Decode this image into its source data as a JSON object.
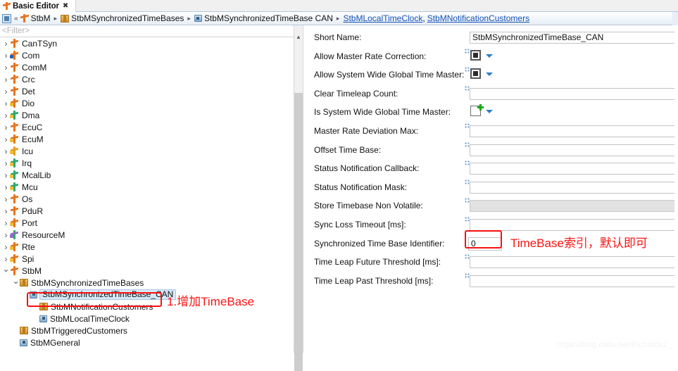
{
  "tab": {
    "label": "Basic Editor",
    "close": "✖",
    "icon": "plug-icon"
  },
  "breadcrumb": {
    "home_icon": "home-icon",
    "collapse": "«",
    "segments": [
      {
        "label": "StbM",
        "icon": "plug-icon"
      },
      {
        "label": "StbMSynchronizedTimeBases",
        "icon": "package-icon"
      },
      {
        "label": "StbMSynchronizedTimeBase CAN",
        "icon": "element-icon"
      }
    ],
    "links": [
      {
        "label": "StbMLocalTimeClock"
      },
      {
        "label": "StbMNotificationCustomers"
      }
    ],
    "separator": "▸",
    "comma": ","
  },
  "filter": {
    "placeholder": "<Filter>",
    "value": "<Filter>"
  },
  "tree": [
    {
      "label": "CanTSyn",
      "depth": 0,
      "twist": "closed",
      "icon": "plug",
      "color": "orange"
    },
    {
      "label": "Com",
      "depth": 0,
      "twist": "closed",
      "icon": "plug",
      "color": "orange-blue"
    },
    {
      "label": "ComM",
      "depth": 0,
      "twist": "closed",
      "icon": "plug",
      "color": "orange"
    },
    {
      "label": "Crc",
      "depth": 0,
      "twist": "closed",
      "icon": "plug",
      "color": "orange"
    },
    {
      "label": "Det",
      "depth": 0,
      "twist": "closed",
      "icon": "plug",
      "color": "orange"
    },
    {
      "label": "Dio",
      "depth": 0,
      "twist": "closed",
      "icon": "plug",
      "color": "orange-yellow"
    },
    {
      "label": "Dma",
      "depth": 0,
      "twist": "closed",
      "icon": "plug",
      "color": "green-yellow"
    },
    {
      "label": "EcuC",
      "depth": 0,
      "twist": "closed",
      "icon": "plug",
      "color": "orange"
    },
    {
      "label": "EcuM",
      "depth": 0,
      "twist": "closed",
      "icon": "plug",
      "color": "orange-yellow"
    },
    {
      "label": "Icu",
      "depth": 0,
      "twist": "closed",
      "icon": "plug",
      "color": "yellow"
    },
    {
      "label": "Irq",
      "depth": 0,
      "twist": "closed",
      "icon": "plug",
      "color": "green-yellow"
    },
    {
      "label": "McalLib",
      "depth": 0,
      "twist": "closed",
      "icon": "plug",
      "color": "green-yellow"
    },
    {
      "label": "Mcu",
      "depth": 0,
      "twist": "closed",
      "icon": "plug",
      "color": "green-yellow"
    },
    {
      "label": "Os",
      "depth": 0,
      "twist": "closed",
      "icon": "plug",
      "color": "orange"
    },
    {
      "label": "PduR",
      "depth": 0,
      "twist": "closed",
      "icon": "plug",
      "color": "orange"
    },
    {
      "label": "Port",
      "depth": 0,
      "twist": "closed",
      "icon": "plug",
      "color": "orange-yellow"
    },
    {
      "label": "ResourceM",
      "depth": 0,
      "twist": "closed",
      "icon": "plug",
      "color": "purple-green"
    },
    {
      "label": "Rte",
      "depth": 0,
      "twist": "closed",
      "icon": "plug",
      "color": "orange-yellow"
    },
    {
      "label": "Spi",
      "depth": 0,
      "twist": "closed",
      "icon": "plug",
      "color": "orange-yellow"
    },
    {
      "label": "StbM",
      "depth": 0,
      "twist": "open",
      "icon": "plug",
      "color": "orange"
    },
    {
      "label": "StbMSynchronizedTimeBases",
      "depth": 1,
      "twist": "open",
      "icon": "package",
      "color": ""
    },
    {
      "label": "StbMSynchronizedTimeBase_CAN",
      "depth": 2,
      "twist": "none",
      "icon": "element",
      "color": "",
      "selected": true
    },
    {
      "label": "StbMNotificationCustomers",
      "depth": 3,
      "twist": "none",
      "icon": "package",
      "color": ""
    },
    {
      "label": "StbMLocalTimeClock",
      "depth": 3,
      "twist": "none",
      "icon": "element",
      "color": ""
    },
    {
      "label": "StbMTriggeredCustomers",
      "depth": 1,
      "twist": "none",
      "icon": "package",
      "color": ""
    },
    {
      "label": "StbMGeneral",
      "depth": 1,
      "twist": "none",
      "icon": "element",
      "color": ""
    }
  ],
  "form": {
    "fields": [
      {
        "label": "Short Name:",
        "type": "text",
        "value": "StbMSynchronizedTimeBase_CAN",
        "handle": false
      },
      {
        "label": "Allow Master Rate Correction:",
        "type": "checkbox",
        "state": "checked",
        "handle": true
      },
      {
        "label": "Allow System Wide Global Time Master:",
        "type": "checkbox",
        "state": "checked",
        "handle": true
      },
      {
        "label": "Clear Timeleap Count:",
        "type": "text",
        "value": "",
        "handle": true
      },
      {
        "label": "Is System Wide Global Time Master:",
        "type": "checkbox",
        "state": "empty-plus",
        "handle": false
      },
      {
        "label": "Master Rate Deviation Max:",
        "type": "text",
        "value": "",
        "handle": true
      },
      {
        "label": "Offset Time Base:",
        "type": "text",
        "value": "",
        "handle": true
      },
      {
        "label": "Status Notification Callback:",
        "type": "text",
        "value": "",
        "handle": true
      },
      {
        "label": "Status Notification Mask:",
        "type": "text",
        "value": "",
        "handle": true
      },
      {
        "label": "Store Timebase Non Volatile:",
        "type": "text",
        "value": "",
        "handle": true,
        "disabled": true
      },
      {
        "label": "Sync Loss Timeout [ms]:",
        "type": "text",
        "value": "",
        "handle": true
      },
      {
        "label": "Synchronized Time Base Identifier:",
        "type": "text-narrow",
        "value": "0",
        "handle": false,
        "highlight": true
      },
      {
        "label": "Time Leap Future Threshold [ms]:",
        "type": "text",
        "value": "",
        "handle": true
      },
      {
        "label": "Time Leap Past Threshold [ms]:",
        "type": "text",
        "value": "",
        "handle": true
      }
    ]
  },
  "annotations": {
    "tree_note": "1.增加TimeBase",
    "field_note": "TimeBase索引，默认即可",
    "color": "#fb1414"
  },
  "watermark": "https://blog.csdn.net/RichardsZ_"
}
